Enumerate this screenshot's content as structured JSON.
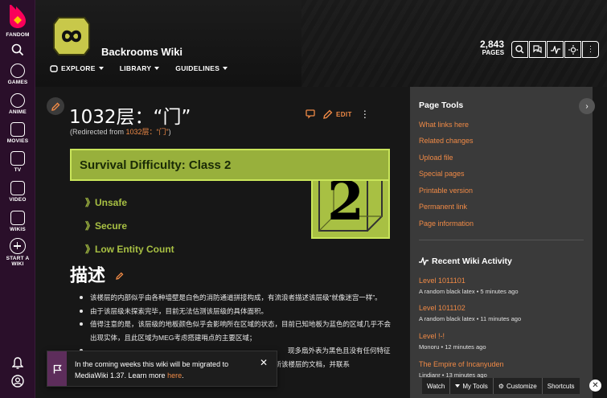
{
  "rail": {
    "brand": "FANDOM",
    "items": [
      {
        "label": "GAMES",
        "icon": "games-icon"
      },
      {
        "label": "ANIME",
        "icon": "anime-icon"
      },
      {
        "label": "MOVIES",
        "icon": "movies-icon"
      },
      {
        "label": "TV",
        "icon": "tv-icon"
      },
      {
        "label": "VIDEO",
        "icon": "video-icon"
      },
      {
        "label": "WIKIS",
        "icon": "wikis-icon"
      }
    ],
    "start_wiki_line1": "START A",
    "start_wiki_line2": "WIKI"
  },
  "header": {
    "wiki_title": "Backrooms Wiki",
    "nav": [
      "EXPLORE",
      "LIBRARY",
      "GUIDELINES"
    ],
    "pages_count": "2,843",
    "pages_label": "PAGES"
  },
  "article": {
    "title": "1032层：“门”",
    "redirect_prefix": "(Redirected from ",
    "redirect_link": "1032层：“门”",
    "redirect_suffix": ")",
    "edit_label": "EDIT",
    "difficulty": {
      "title": "Survival Difficulty: Class 2",
      "class_number": "2",
      "items": [
        "》Unsafe",
        "》Secure",
        "》Low Entity Count"
      ]
    },
    "section_heading": "描述",
    "bullets": [
      "该楼层的内部似乎由各种墙壁是白色的消防通道拼接构成，有流浪者描述该层级“就像迷宫一样”。",
      "由于该层级未探索完毕，目前无法估测该层级的具体面积。",
      "值得注意的是，该层级的地板颜色似乎会影响所在区域的状态，目前已知地板为蓝色的区域几乎不会出现实体，且此区域为MEG考虑搭建哨点的主要区域；",
      "现多扇外表为黑色且没有任何特征",
      "如果你在探索该层级时发现了其它颜色的地板，请第一时间更新该楼层的文档，并联系"
    ]
  },
  "banner": {
    "text_before": "In the coming weeks this wiki will be migrated to MediaWiki 1.37. Learn more ",
    "link": "here",
    "text_after": "."
  },
  "panel": {
    "page_tools_title": "Page Tools",
    "page_tools": [
      "What links here",
      "Related changes",
      "Upload file",
      "Special pages",
      "Printable version",
      "Permanent link",
      "Page information"
    ],
    "activity_title": "Recent Wiki Activity",
    "activity": [
      {
        "title": "Level 1011101",
        "meta": "A random black latex • 5 minutes ago"
      },
      {
        "title": "Level 1011102",
        "meta": "A random black latex • 11 minutes ago"
      },
      {
        "title": "Level !-!",
        "meta": "Monoru • 12 minutes ago"
      },
      {
        "title": "The Empire of Incanyuden",
        "meta": "Lindianr • 13 minutes ago"
      }
    ]
  },
  "toolbar": {
    "watch": "Watch",
    "my_tools": "My Tools",
    "customize": "Customize",
    "shortcuts": "Shortcuts"
  },
  "colors": {
    "accent": "#f08a46",
    "difficulty_green": "#a8c043",
    "rail_purple": "#2a0f2a"
  }
}
